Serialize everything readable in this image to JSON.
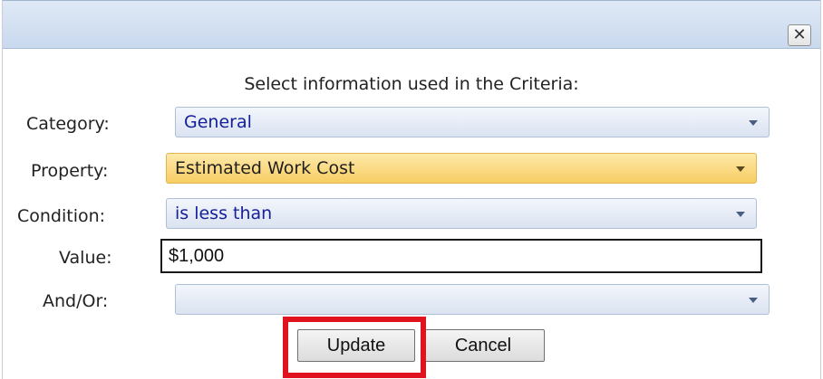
{
  "dialog": {
    "close_glyph": "✕",
    "instruction": "Select information used in the Criteria:"
  },
  "form": {
    "category": {
      "label": "Category:",
      "value": "General"
    },
    "property": {
      "label": "Property:",
      "value": "Estimated Work Cost"
    },
    "condition": {
      "label": "Condition:",
      "value": "is less than"
    },
    "value": {
      "label": "Value:",
      "value": "$1,000"
    },
    "andor": {
      "label": "And/Or:",
      "value": ""
    }
  },
  "buttons": {
    "update_label": "Update",
    "cancel_label": "Cancel"
  },
  "colors": {
    "highlight": "#e0141e",
    "active_dropdown": "#f8cd63",
    "dropdown_text": "#14209c"
  },
  "icons": {
    "close": "close-icon",
    "dropdown": "chevron-down-icon"
  }
}
